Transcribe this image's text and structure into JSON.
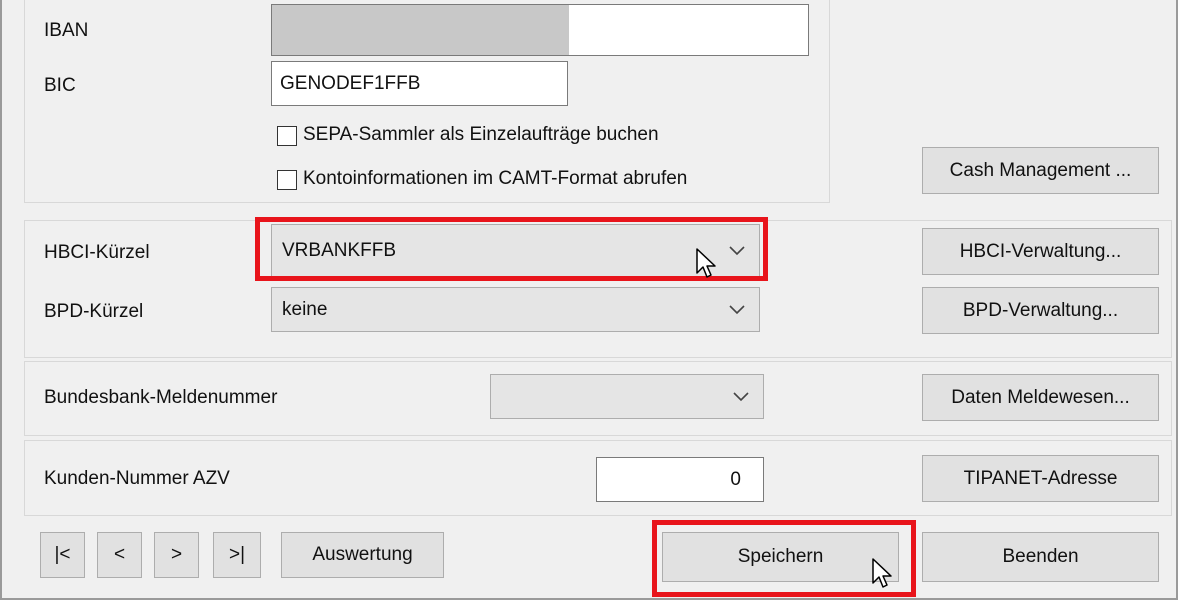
{
  "account": {
    "iban_label": "IBAN",
    "bic_label": "BIC",
    "bic_value": "GENODEF1FFB",
    "sepa_checkbox_label": "SEPA-Sammler als Einzelaufträge buchen",
    "camt_checkbox_label": "Kontoinformationen im CAMT-Format abrufen",
    "cash_management_button": "Cash Management ..."
  },
  "hbci": {
    "hbci_label": "HBCI-Kürzel",
    "hbci_value": "VRBANKFFB",
    "hbci_button": "HBCI-Verwaltung...",
    "bpd_label": "BPD-Kürzel",
    "bpd_value": "keine",
    "bpd_button": "BPD-Verwaltung..."
  },
  "meldewesen": {
    "label": "Bundesbank-Meldenummer",
    "value": "",
    "button": "Daten Meldewesen..."
  },
  "azv": {
    "label": "Kunden-Nummer AZV",
    "value": "0",
    "button": "TIPANET-Adresse"
  },
  "footer": {
    "first": "|<",
    "prev": "<",
    "next": ">",
    "last": ">|",
    "report_button": "Auswertung",
    "save_button": "Speichern",
    "close_button": "Beenden"
  },
  "colors": {
    "highlight": "#e8141b",
    "window_bg": "#f0f0f0",
    "button_bg": "#e1e1e1"
  },
  "icons": [
    "chevron-down-icon",
    "mouse-cursor-icon"
  ]
}
